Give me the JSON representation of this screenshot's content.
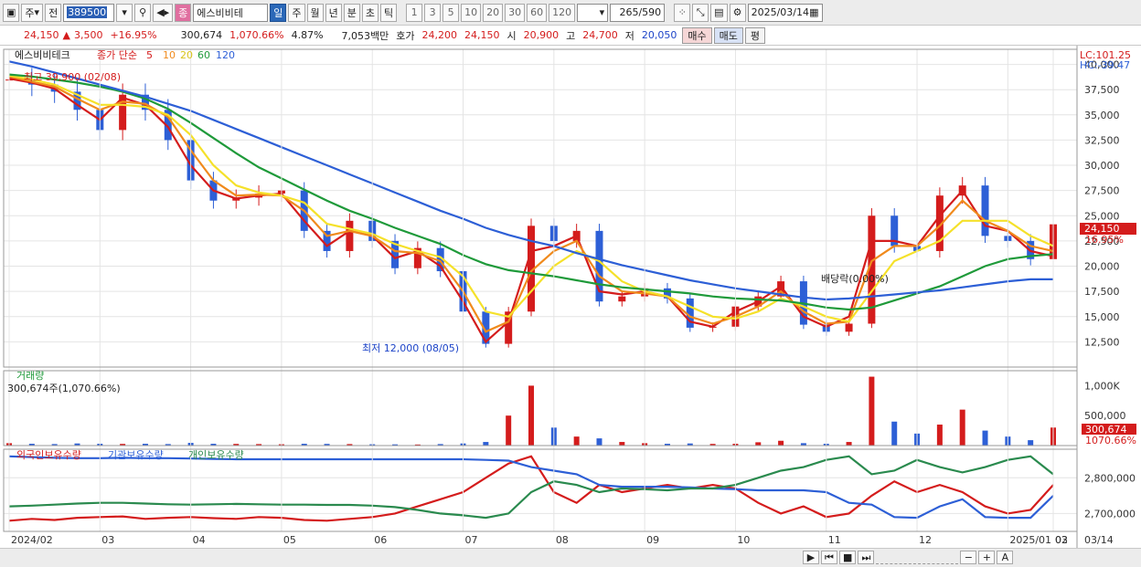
{
  "toolbar": {
    "market_label": "주",
    "prev_label": "전",
    "stock_code": "389500",
    "stock_name": "에스비비테",
    "badge_label": "종",
    "periods": [
      "일",
      "주",
      "월",
      "년",
      "분",
      "초",
      "틱"
    ],
    "active_period": "일",
    "minute_options": [
      "1",
      "3",
      "5",
      "10",
      "20",
      "30",
      "60",
      "120"
    ],
    "bar_count": "265",
    "bar_total": "/590",
    "date": "2025/03/14"
  },
  "quote": {
    "price": "24,150",
    "change": "3,500",
    "change_pct": "+16.95%",
    "volume": "300,674",
    "volume_ratio": "1,070.66%",
    "turnover": "4.87%",
    "amount": "7,053백만",
    "ask_label": "호가",
    "ask": "24,200",
    "bid": "24,150",
    "open_label": "시",
    "open": "20,900",
    "high_label": "고",
    "high": "24,700",
    "low_label": "저",
    "low": "20,050",
    "buy_label": "매수",
    "sell_label": "매도",
    "eval_label": "평"
  },
  "legend": {
    "name": "에스비비테크",
    "type": "종가 단순",
    "ma": [
      {
        "label": "5",
        "color": "#d41c1c"
      },
      {
        "label": "10",
        "color": "#f08a1c"
      },
      {
        "label": "20",
        "color": "#f5e12a"
      },
      {
        "label": "60",
        "color": "#1f9a3a"
      },
      {
        "label": "120",
        "color": "#2d5fd6"
      }
    ]
  },
  "annotations": {
    "lc": "LC:101.25",
    "hc": "HC:-39.47",
    "high_note": "최고 39,900 (02/08)",
    "low_note": "최저 12,000 (08/05)",
    "dividend_note": "배당락(0.00%)",
    "last_price_label": "24,150",
    "last_pct_label": "16.95%",
    "volume_title": "거래량",
    "volume_note": "300,674주(1,070.66%)",
    "volume_last_label": "300,674",
    "volume_pct_label": "1070.66%",
    "holdings_legend": [
      "외국인보유수량",
      "기관보유수량",
      "개인보유수량"
    ]
  },
  "chart_data": [
    {
      "type": "candlestick",
      "title": "에스비비테크 종가 단순",
      "x_ticks": [
        "2024/02",
        "03",
        "04",
        "05",
        "06",
        "07",
        "08",
        "09",
        "10",
        "11",
        "12",
        "2025/01",
        "02",
        "03",
        "03/14"
      ],
      "ylim": [
        10000,
        41500
      ],
      "y_ticks": [
        12500,
        15000,
        17500,
        20000,
        22500,
        25000,
        27500,
        30000,
        32500,
        35000,
        37500,
        40000
      ],
      "series": [
        {
          "name": "5",
          "color": "#d41c1c",
          "values": [
            38600,
            38200,
            37600,
            36000,
            34500,
            36700,
            36000,
            33800,
            30000,
            27500,
            26700,
            27000,
            27200,
            24500,
            22000,
            23500,
            23000,
            20800,
            21500,
            20000,
            16500,
            12500,
            14500,
            21500,
            22000,
            23000,
            17500,
            17200,
            17500,
            17000,
            14500,
            14000,
            15500,
            16500,
            18000,
            15000,
            14000,
            15000,
            22500,
            22500,
            22000,
            25000,
            27500,
            24000,
            23500,
            21500,
            21000
          ]
        },
        {
          "name": "10",
          "color": "#f08a1c",
          "values": [
            38800,
            38300,
            37800,
            36600,
            35500,
            36300,
            36100,
            34800,
            31500,
            28500,
            27000,
            27100,
            27000,
            25500,
            23000,
            23500,
            23000,
            21500,
            21300,
            20500,
            17500,
            13500,
            14500,
            19500,
            21500,
            22500,
            19000,
            17500,
            17300,
            17000,
            15000,
            14300,
            15000,
            16000,
            17500,
            15500,
            14300,
            14500,
            20500,
            22000,
            22000,
            24000,
            26500,
            24500,
            23500,
            22000,
            21500
          ]
        },
        {
          "name": "20",
          "color": "#f5e12a",
          "values": [
            38900,
            38500,
            38000,
            37000,
            36000,
            36000,
            35800,
            35000,
            33000,
            30000,
            28000,
            27300,
            27000,
            26300,
            24200,
            23700,
            23200,
            22200,
            21500,
            20900,
            19000,
            15500,
            15000,
            17500,
            20000,
            21500,
            20500,
            18500,
            17500,
            17000,
            16000,
            15000,
            14800,
            15500,
            16800,
            16000,
            15000,
            14500,
            17500,
            20500,
            21500,
            22500,
            24500,
            24500,
            24500,
            23000,
            22000
          ]
        },
        {
          "name": "60",
          "color": "#1f9a3a",
          "values": [
            39000,
            38800,
            38500,
            38200,
            37800,
            37300,
            36600,
            35600,
            34200,
            32700,
            31200,
            29800,
            28700,
            27600,
            26500,
            25500,
            24700,
            23800,
            23000,
            22200,
            21100,
            20200,
            19600,
            19300,
            19000,
            18600,
            18200,
            17900,
            17700,
            17500,
            17300,
            17000,
            16800,
            16700,
            16600,
            16300,
            15900,
            15700,
            15900,
            16600,
            17300,
            18000,
            19000,
            20000,
            20700,
            21000,
            21200
          ]
        },
        {
          "name": "120",
          "color": "#2d5fd6",
          "values": [
            40300,
            39800,
            39200,
            38600,
            38000,
            37400,
            36800,
            36100,
            35400,
            34500,
            33600,
            32700,
            31800,
            30900,
            30000,
            29100,
            28200,
            27300,
            26400,
            25500,
            24700,
            23800,
            23100,
            22500,
            22000,
            21300,
            20700,
            20100,
            19600,
            19100,
            18600,
            18200,
            17800,
            17500,
            17200,
            16900,
            16700,
            16800,
            17000,
            17200,
            17400,
            17600,
            17900,
            18200,
            18500,
            18700,
            18700
          ]
        }
      ],
      "close": [
        38500,
        38000,
        37300,
        35500,
        33500,
        37000,
        35500,
        32500,
        28500,
        26500,
        26800,
        27200,
        27500,
        23500,
        21500,
        24500,
        22500,
        19800,
        21800,
        19500,
        15500,
        12300,
        15500,
        24000,
        22500,
        23500,
        16500,
        17000,
        17800,
        16800,
        13900,
        14000,
        16000,
        17000,
        18500,
        14200,
        13500,
        14300,
        25000,
        22000,
        21500,
        27000,
        28000,
        23000,
        22500,
        20700,
        24150
      ]
    },
    {
      "type": "bar",
      "title": "거래량",
      "ylim": [
        0,
        1250000
      ],
      "y_ticks": [
        500000,
        1000000
      ],
      "y_tick_labels": [
        "500,000",
        "1,000K"
      ],
      "values": [
        40000,
        30000,
        25000,
        35000,
        30000,
        28000,
        30000,
        25000,
        45000,
        30000,
        28000,
        25000,
        22000,
        30000,
        28000,
        25000,
        22000,
        20000,
        18000,
        25000,
        35000,
        60000,
        500000,
        1000000,
        300000,
        150000,
        120000,
        60000,
        40000,
        30000,
        35000,
        28000,
        30000,
        55000,
        80000,
        40000,
        30000,
        60000,
        1150000,
        400000,
        200000,
        350000,
        600000,
        250000,
        150000,
        90000,
        300674
      ]
    },
    {
      "type": "line",
      "title": "외국인보유수량 기관보유수량 개인보유수량",
      "ylim": [
        2650000,
        2880000
      ],
      "y_ticks": [
        2700000,
        2800000
      ],
      "y_tick_labels": [
        "2,700,000",
        "2,800,000"
      ],
      "series": [
        {
          "name": "외국인보유수량",
          "color": "#d41c1c",
          "values": [
            2680000,
            2685000,
            2682000,
            2688000,
            2690000,
            2692000,
            2685000,
            2688000,
            2690000,
            2687000,
            2685000,
            2690000,
            2688000,
            2682000,
            2680000,
            2685000,
            2690000,
            2700000,
            2720000,
            2740000,
            2760000,
            2800000,
            2840000,
            2860000,
            2760000,
            2730000,
            2780000,
            2760000,
            2770000,
            2780000,
            2770000,
            2780000,
            2770000,
            2730000,
            2700000,
            2720000,
            2690000,
            2700000,
            2750000,
            2790000,
            2760000,
            2780000,
            2760000,
            2720000,
            2700000,
            2710000,
            2780000
          ]
        },
        {
          "name": "기관보유수량",
          "color": "#2d5fd6",
          "values": [
            2860000,
            2858000,
            2856000,
            2855000,
            2855000,
            2856000,
            2855000,
            2855000,
            2854000,
            2853000,
            2852000,
            2852000,
            2852000,
            2852000,
            2852000,
            2852000,
            2852000,
            2852000,
            2852000,
            2852000,
            2852000,
            2850000,
            2848000,
            2830000,
            2820000,
            2810000,
            2780000,
            2775000,
            2775000,
            2775000,
            2773000,
            2770000,
            2768000,
            2765000,
            2765000,
            2765000,
            2760000,
            2730000,
            2725000,
            2690000,
            2688000,
            2720000,
            2740000,
            2690000,
            2688000,
            2688000,
            2750000
          ]
        },
        {
          "name": "개인보유수량",
          "color": "#2a8a4e",
          "values": [
            2720000,
            2722000,
            2725000,
            2728000,
            2730000,
            2730000,
            2728000,
            2726000,
            2725000,
            2726000,
            2727000,
            2726000,
            2725000,
            2725000,
            2724000,
            2724000,
            2722000,
            2718000,
            2710000,
            2700000,
            2695000,
            2688000,
            2700000,
            2760000,
            2790000,
            2780000,
            2760000,
            2770000,
            2768000,
            2765000,
            2770000,
            2770000,
            2780000,
            2800000,
            2820000,
            2830000,
            2850000,
            2860000,
            2810000,
            2820000,
            2850000,
            2830000,
            2815000,
            2830000,
            2850000,
            2860000,
            2810000
          ]
        }
      ]
    }
  ]
}
